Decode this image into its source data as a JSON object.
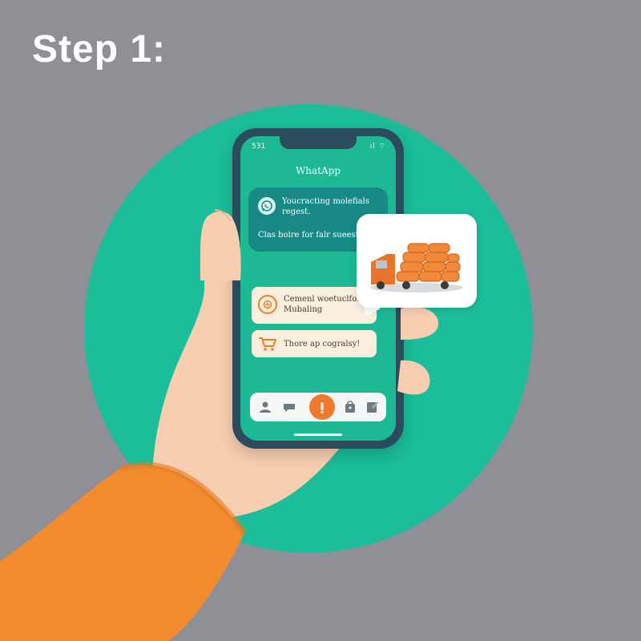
{
  "header": {
    "title": "Step 1:"
  },
  "phone": {
    "status_time": "531",
    "status_icons": "ıl ⌔",
    "app_title": "WhatApp",
    "message": {
      "line1": "Youcracting molefials regest.",
      "line2": "Clas boire for falr sueest."
    },
    "cards": [
      {
        "text": "Cemenl woetuclfor Mubaling"
      },
      {
        "text": "Thore ap cogralsy!"
      }
    ]
  },
  "colors": {
    "background": "#8f9096",
    "circle": "#1bbd9a",
    "phone_screen": "#1db995",
    "accent": "#f07a2a",
    "sleeve": "#f28a2e"
  },
  "icons": [
    "whatsapp-icon",
    "chat-badge-icon",
    "cart-icon",
    "profile-icon",
    "chat-icon",
    "center-action-icon",
    "bag-icon",
    "edit-icon",
    "delivery-truck-icon"
  ]
}
